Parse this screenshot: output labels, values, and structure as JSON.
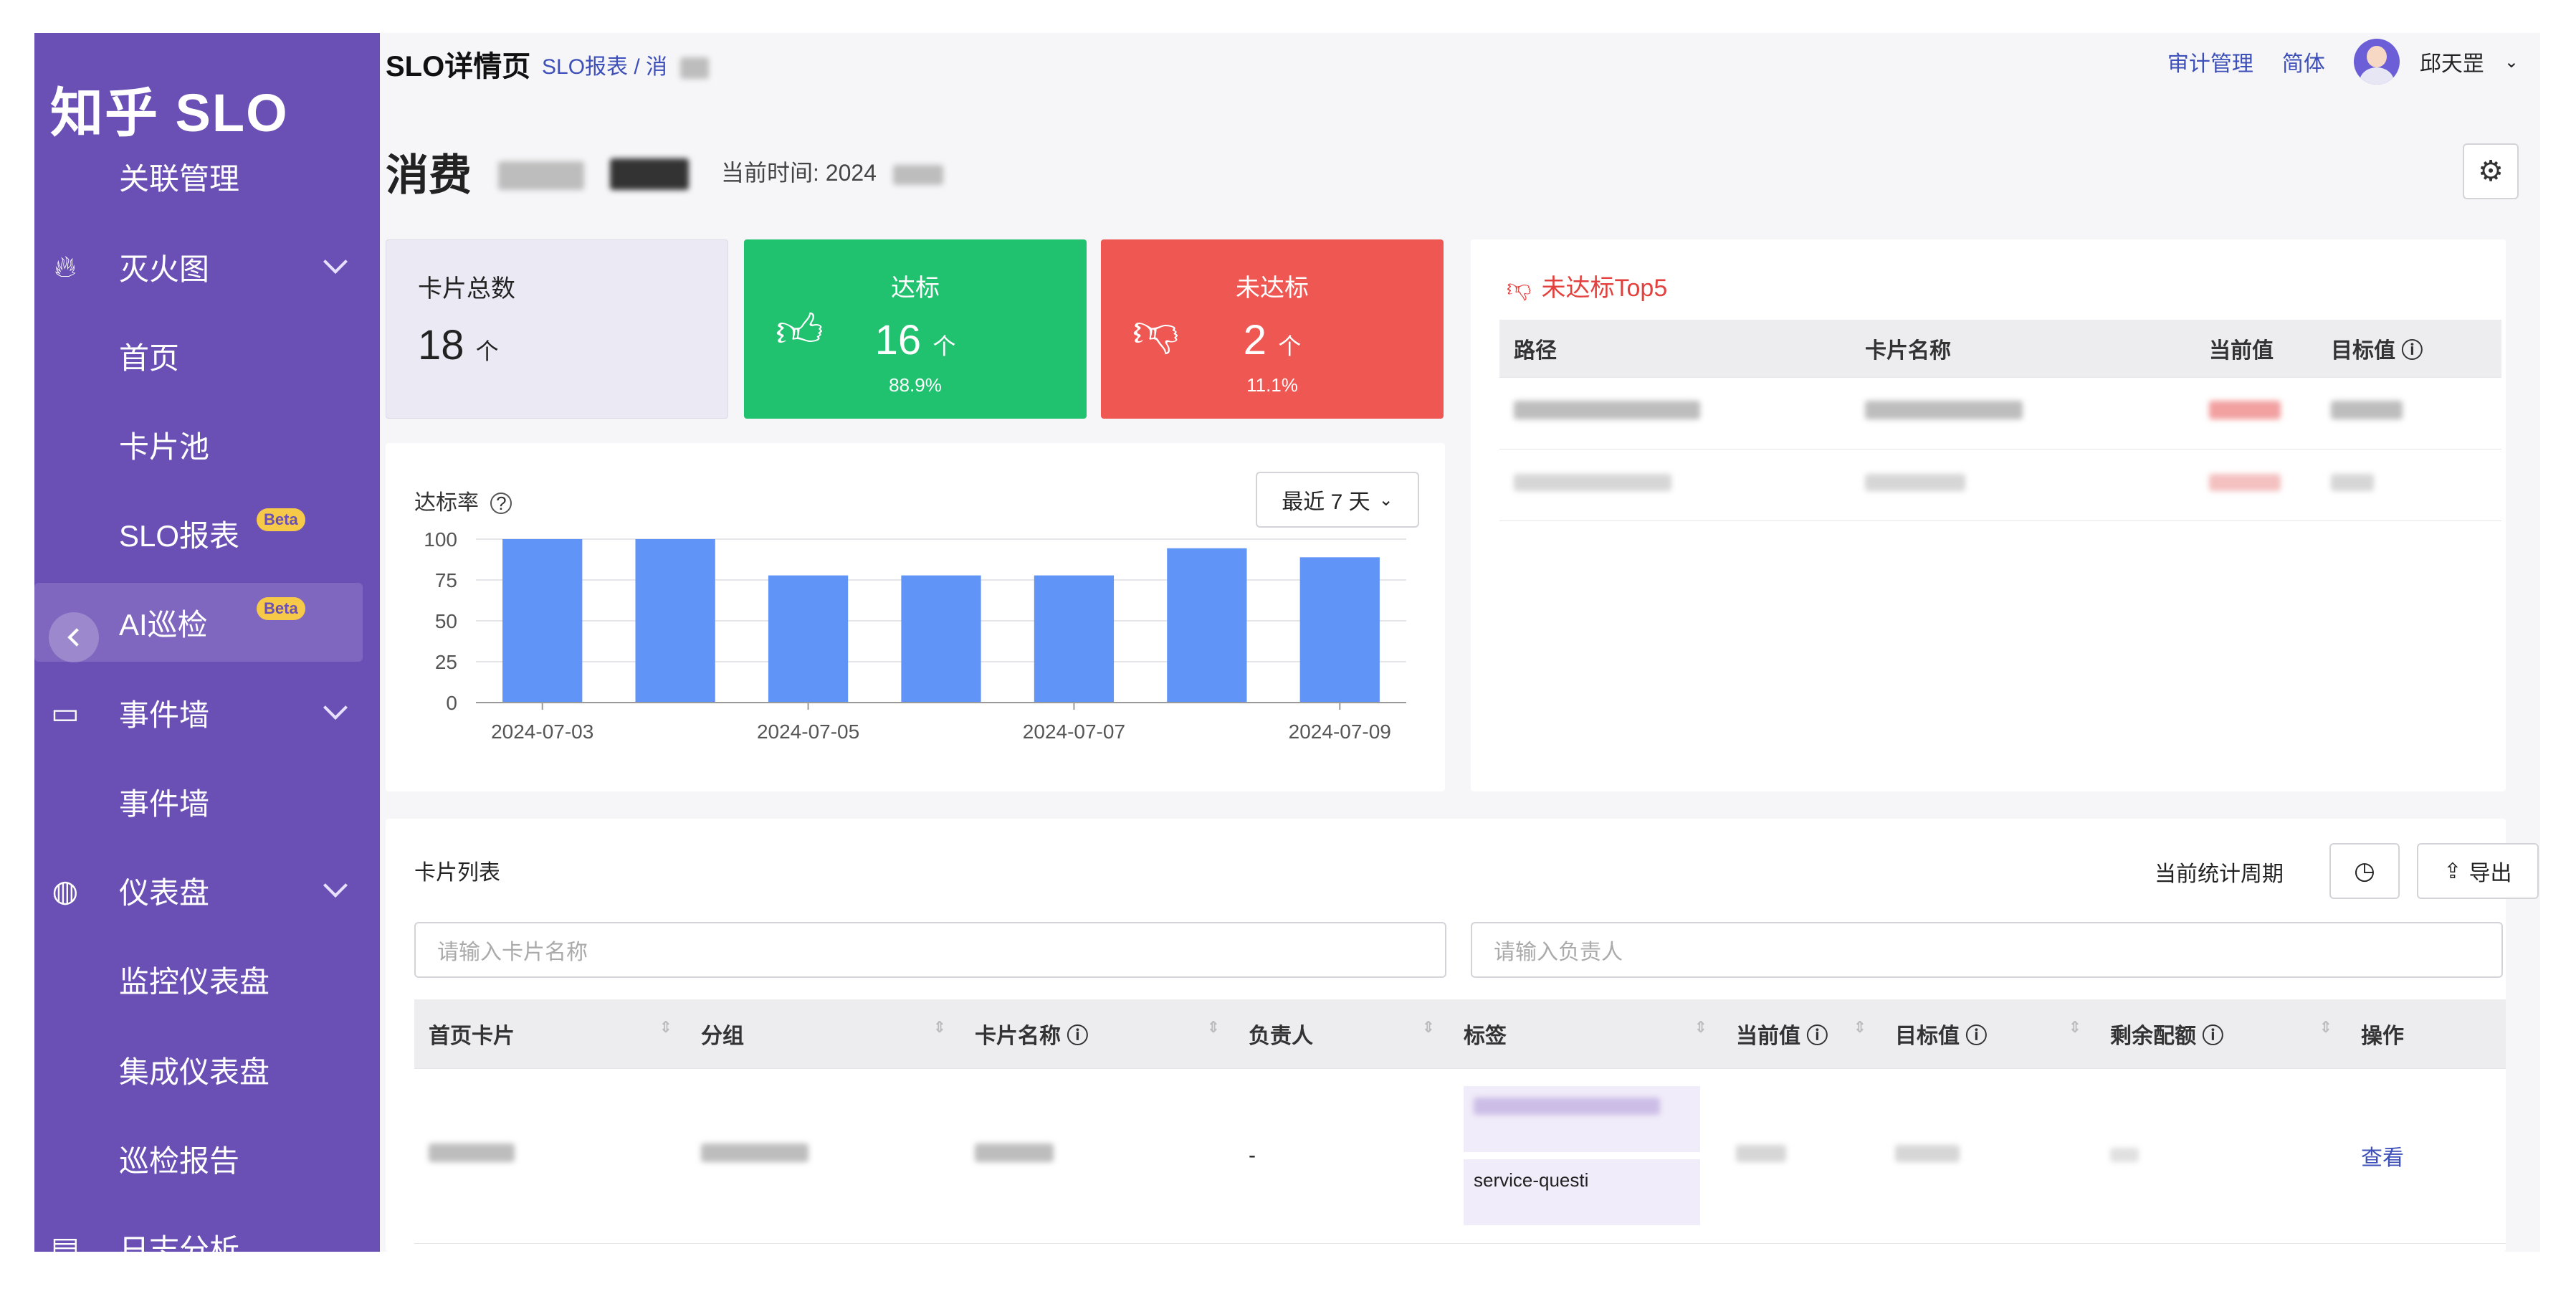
{
  "sidebar": {
    "brand": "知乎 SLO",
    "items": [
      {
        "label": "关联管理",
        "icon": "",
        "chevron": false
      },
      {
        "label": "灭火图",
        "icon": "fire-icon",
        "chevron": true
      },
      {
        "label": "首页",
        "icon": "",
        "chevron": false
      },
      {
        "label": "卡片池",
        "icon": "",
        "chevron": false
      },
      {
        "label": "SLO报表",
        "icon": "",
        "chevron": false,
        "badge": "Beta"
      },
      {
        "label": "AI巡检",
        "icon": "",
        "chevron": false,
        "badge": "Beta",
        "active": true
      },
      {
        "label": "事件墙",
        "icon": "monitor-icon",
        "chevron": true
      },
      {
        "label": "事件墙",
        "icon": "",
        "chevron": false
      },
      {
        "label": "仪表盘",
        "icon": "gauge-icon",
        "chevron": true
      },
      {
        "label": "监控仪表盘",
        "icon": "",
        "chevron": false
      },
      {
        "label": "集成仪表盘",
        "icon": "",
        "chevron": false
      },
      {
        "label": "巡检报告",
        "icon": "",
        "chevron": false
      },
      {
        "label": "日志分析",
        "icon": "log-icon",
        "chevron": false
      }
    ]
  },
  "header": {
    "title": "SLO详情页",
    "breadcrumb": "SLO报表 / 消",
    "audit": "审计管理",
    "lang": "简体",
    "user": "邱天罡"
  },
  "page": {
    "heading": "消费",
    "time_label": "当前时间: 2024"
  },
  "stats": {
    "total": {
      "title": "卡片总数",
      "value": "18",
      "unit": "个"
    },
    "ok": {
      "title": "达标",
      "value": "16",
      "unit": "个",
      "pct": "88.9%"
    },
    "bad": {
      "title": "未达标",
      "value": "2",
      "unit": "个",
      "pct": "11.1%"
    }
  },
  "chart_panel": {
    "label": "达标率",
    "range_select": "最近 7 天"
  },
  "chart_data": {
    "type": "bar",
    "categories": [
      "2024-07-03",
      "2024-07-04",
      "2024-07-05",
      "2024-07-06",
      "2024-07-07",
      "2024-07-08",
      "2024-07-09"
    ],
    "values": [
      100,
      100,
      77.8,
      77.8,
      77.8,
      94.4,
      88.9
    ],
    "xtick_labels": [
      "2024-07-03",
      "",
      "2024-07-05",
      "",
      "2024-07-07",
      "",
      "2024-07-09"
    ],
    "yticks": [
      0,
      25,
      50,
      75,
      100
    ],
    "ylim": [
      0,
      100
    ],
    "color": "#6194f7"
  },
  "top5": {
    "title": "未达标Top5",
    "columns": [
      "路径",
      "卡片名称",
      "当前值",
      "目标值"
    ]
  },
  "list": {
    "title": "卡片列表",
    "cycle_label": "当前统计周期",
    "export_label": "导出",
    "name_placeholder": "请输入卡片名称",
    "owner_placeholder": "请输入负责人",
    "columns": [
      "首页卡片",
      "分组",
      "卡片名称",
      "负责人",
      "标签",
      "当前值",
      "目标值",
      "剩余配额",
      "操作"
    ],
    "row": {
      "owner": "-",
      "tag2": "service-questi",
      "action": "查看"
    }
  }
}
